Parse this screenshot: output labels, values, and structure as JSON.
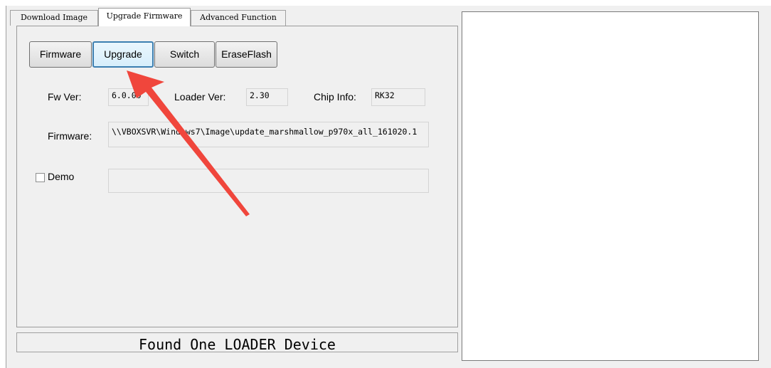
{
  "tabs": [
    {
      "label": "Download Image"
    },
    {
      "label": "Upgrade Firmware"
    },
    {
      "label": "Advanced Function"
    }
  ],
  "toolbar": {
    "firmware_label": "Firmware",
    "upgrade_label": "Upgrade",
    "switch_label": "Switch",
    "eraseflash_label": "EraseFlash"
  },
  "fields": {
    "fw_ver_label": "Fw Ver:",
    "fw_ver_value": "6.0.00",
    "loader_ver_label": "Loader Ver:",
    "loader_ver_value": "2.30",
    "chip_info_label": "Chip Info:",
    "chip_info_value": "RK32",
    "firmware_label": "Firmware:",
    "firmware_value": "\\\\VBOXSVR\\Windows7\\Image\\update_marshmallow_p970x_all_161020.1",
    "demo_label": "Demo",
    "demo_checked": false,
    "demo_value": ""
  },
  "status": {
    "message": "Found One LOADER Device"
  },
  "colors": {
    "annotation_arrow": "#f0463c",
    "focus_border": "#3c7fb1"
  }
}
